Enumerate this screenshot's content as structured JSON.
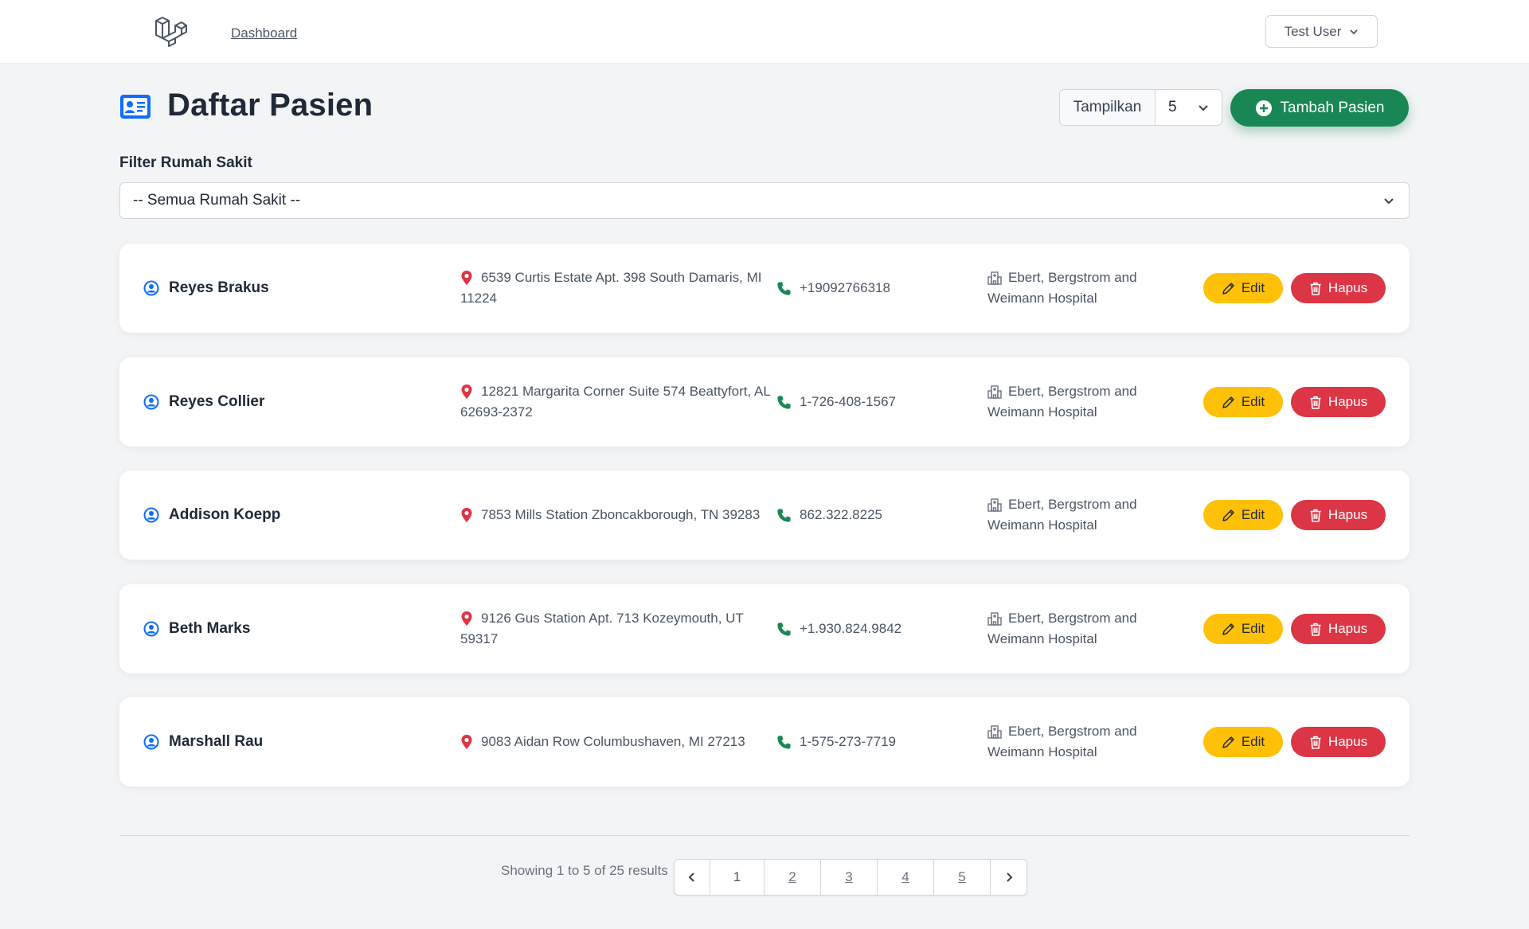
{
  "nav": {
    "dashboard_link": "Dashboard",
    "user_name": "Test User"
  },
  "header": {
    "title": "Daftar Pasien",
    "show_label": "Tampilkan",
    "per_page": "5",
    "add_button": "Tambah Pasien"
  },
  "filter": {
    "label": "Filter Rumah Sakit",
    "selected": "-- Semua Rumah Sakit --"
  },
  "patients": [
    {
      "name": "Reyes Brakus",
      "address": "6539 Curtis Estate Apt. 398 South Damaris, MI 11224",
      "phone": "+19092766318",
      "hospital": "Ebert, Bergstrom and Weimann Hospital"
    },
    {
      "name": "Reyes Collier",
      "address": "12821 Margarita Corner Suite 574 Beattyfort, AL 62693-2372",
      "phone": "1-726-408-1567",
      "hospital": "Ebert, Bergstrom and Weimann Hospital"
    },
    {
      "name": "Addison Koepp",
      "address": "7853 Mills Station Zboncakborough, TN 39283",
      "phone": "862.322.8225",
      "hospital": "Ebert, Bergstrom and Weimann Hospital"
    },
    {
      "name": "Beth Marks",
      "address": "9126 Gus Station Apt. 713 Kozeymouth, UT 59317",
      "phone": "+1.930.824.9842",
      "hospital": "Ebert, Bergstrom and Weimann Hospital"
    },
    {
      "name": "Marshall Rau",
      "address": "9083 Aidan Row Columbushaven, MI 27213",
      "phone": "1-575-273-7719",
      "hospital": "Ebert, Bergstrom and Weimann Hospital"
    }
  ],
  "actions": {
    "edit_label": "Edit",
    "delete_label": "Hapus"
  },
  "pagination": {
    "summary": "Showing 1 to 5 of 25 results",
    "pages": [
      "1",
      "2",
      "3",
      "4",
      "5"
    ],
    "current": "1"
  },
  "colors": {
    "primary": "#0d6efd",
    "success": "#198754",
    "warning": "#ffc107",
    "danger": "#dc3545"
  },
  "icons": {
    "logo": "laravel-logo-icon",
    "title": "id-card-icon",
    "add": "plus-circle-icon",
    "person": "person-circle-icon",
    "address": "map-pin-icon",
    "phone": "phone-icon",
    "hospital": "hospital-icon",
    "edit": "pencil-icon",
    "delete": "trash-icon"
  }
}
